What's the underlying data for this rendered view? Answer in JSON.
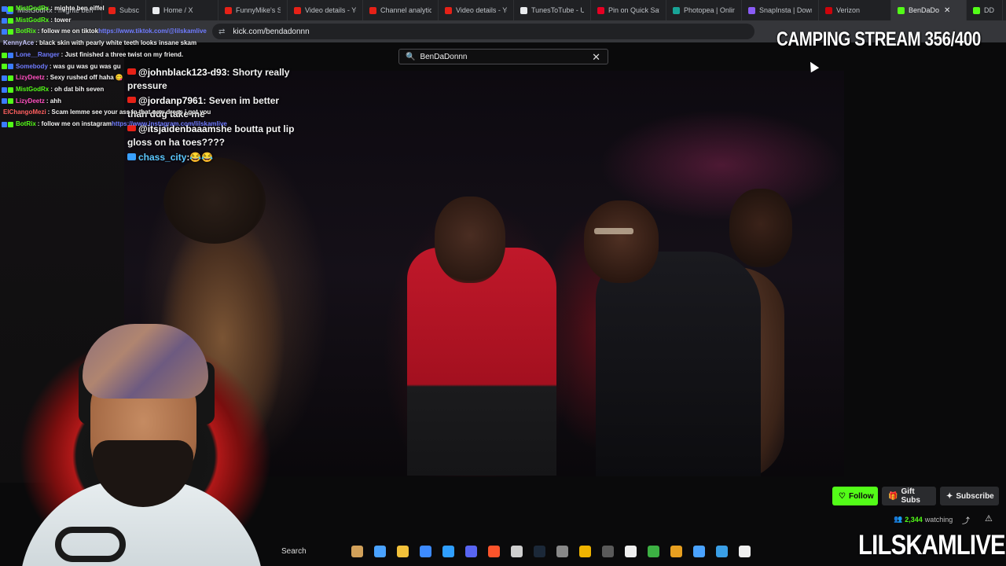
{
  "browser": {
    "tabs": [
      {
        "label": "MistGodRx : mighte ben eiffel",
        "color": "#3b7bff"
      },
      {
        "label": "Subscriptions - Yo",
        "color": "#e62117"
      },
      {
        "label": "Home / X",
        "color": "#e8eaed"
      },
      {
        "label": "FunnyMike's S",
        "color": "#e62117"
      },
      {
        "label": "Video details - Yo",
        "color": "#e62117"
      },
      {
        "label": "Channel analytics",
        "color": "#e62117"
      },
      {
        "label": "Video details - Yo",
        "color": "#e62117"
      },
      {
        "label": "TunesToTube - Up",
        "color": "#e8eaed"
      },
      {
        "label": "Pin on Quick Save",
        "color": "#e60023"
      },
      {
        "label": "Photopea | Online",
        "color": "#18a497"
      },
      {
        "label": "SnapInsta | Down",
        "color": "#8a5cf6"
      },
      {
        "label": "Verizon",
        "color": "#cd040b"
      },
      {
        "label": "BenDaDo",
        "color": "#53fc18",
        "active": true
      },
      {
        "label": "DD",
        "color": "#53fc18"
      }
    ],
    "close_glyph": "✕",
    "url": "kick.com/bendadonnn",
    "tune_glyph": "⇄",
    "bookmark_glyph": "☆",
    "zoom_glyph": "🔍",
    "warn_glyph": "▲"
  },
  "stream_chat": [
    {
      "user": "MistGodRx",
      "user_color": "#53fc18",
      "msg": " : mighte ben eiffel",
      "badges": [
        "#3b7bff",
        "#53fc18"
      ]
    },
    {
      "user": "MistGodRx",
      "user_color": "#53fc18",
      "msg": " : tower",
      "badges": [
        "#3b7bff",
        "#53fc18"
      ]
    },
    {
      "user": "BotRix",
      "user_color": "#53fc18",
      "msg": " : follow me on tiktok ",
      "link": "https://www.tiktok.com/@lilskamlive",
      "badges": [
        "#3b7bff",
        "#53fc18"
      ]
    },
    {
      "user": "KennyAce",
      "user_color": "#c8c8ff",
      "msg": " : black skin with pearly white teeth looks insane skam",
      "badges": []
    },
    {
      "user": "Lone__Ranger",
      "user_color": "#6f7bff",
      "msg": " : Just finished a three twist on my friend.",
      "badges": [
        "#53fc18",
        "#3b7bff"
      ]
    },
    {
      "user": "Somebody",
      "user_color": "#6f7bff",
      "msg": " : was gu was gu was gu",
      "badges": [
        "#53fc18",
        "#3b7bff"
      ]
    },
    {
      "user": "LizyDeetz",
      "user_color": "#ff4fbf",
      "msg": " : Sexy rushed off haha 😋",
      "badges": [
        "#3b7bff",
        "#53fc18"
      ]
    },
    {
      "user": "MistGodRx",
      "user_color": "#53fc18",
      "msg": " : oh dat bih seven",
      "badges": [
        "#3b7bff",
        "#53fc18"
      ]
    },
    {
      "user": "LizyDeetz",
      "user_color": "#ff4fbf",
      "msg": " : ahh",
      "badges": [
        "#3b7bff",
        "#53fc18"
      ]
    },
    {
      "user": "ElChangoMezi",
      "user_color": "#ff5f5f",
      "msg": " : Scam lemme see your ass in that new dress i got you",
      "badges": []
    },
    {
      "user": "BotRix",
      "user_color": "#53fc18",
      "msg": " : follow me on instagram ",
      "link": "https://www.instagram.com/lilskamlive",
      "badges": [
        "#3b7bff",
        "#53fc18"
      ]
    }
  ],
  "search": {
    "value": "BenDaDonnn",
    "mag_glyph": "🔍",
    "clear_glyph": "✕"
  },
  "video_overlay_chat": [
    {
      "platform": "youtube",
      "user": "@johnblack123-d93",
      "text": ": Shorty really pressure"
    },
    {
      "platform": "youtube",
      "user": "@jordanp7961",
      "text": ": Seven im better than ddg take me"
    },
    {
      "platform": "youtube",
      "user": "@itsjaidenbaaam",
      "text": "she boutta put lip gloss on ha toes????"
    },
    {
      "platform": "twitch",
      "user": "chass_city",
      "text": ":😂😂"
    }
  ],
  "header": {
    "camping_title": "CAMPING STREAM 356/400"
  },
  "channel_actions": {
    "follow_label": "Follow",
    "follow_icon": "♡",
    "gift_label": "Gift Subs",
    "gift_icon": "🎁",
    "subscribe_label": "Subscribe",
    "subscribe_icon": "✦",
    "viewers_icon": "👥",
    "viewers_count": "2,344",
    "viewers_suffix": "watching",
    "share_glyph": "⤴",
    "report_glyph": "⚠"
  },
  "taskbar": {
    "search_label": "Search",
    "icons": [
      {
        "name": "widgets-icon",
        "color": "#d2a15a"
      },
      {
        "name": "copilot-icon",
        "color": "#4aa3ff"
      },
      {
        "name": "file-explorer-icon",
        "color": "#f2c13a"
      },
      {
        "name": "store-icon",
        "color": "#3d8bff"
      },
      {
        "name": "photoshop-icon",
        "color": "#2f9fff"
      },
      {
        "name": "discord-icon",
        "color": "#5865f2"
      },
      {
        "name": "brave-icon",
        "color": "#fb542b"
      },
      {
        "name": "obs-icon",
        "color": "#cfcfcf"
      },
      {
        "name": "steam-icon",
        "color": "#1b2838"
      },
      {
        "name": "app-icon",
        "color": "#888888"
      },
      {
        "name": "paint-icon",
        "color": "#f0b400"
      },
      {
        "name": "4k-downloader-icon",
        "color": "#5a5a5a"
      },
      {
        "name": "capcut-icon",
        "color": "#efefef"
      },
      {
        "name": "spotify-like-icon",
        "color": "#3cb043"
      },
      {
        "name": "chrome-icon",
        "color": "#e8a020"
      },
      {
        "name": "notepad-icon",
        "color": "#4aa3ff"
      },
      {
        "name": "photos-icon",
        "color": "#3a9fe6"
      },
      {
        "name": "file-icon",
        "color": "#efefef"
      }
    ]
  },
  "brand": {
    "name": "LILSKAMLIVE"
  }
}
